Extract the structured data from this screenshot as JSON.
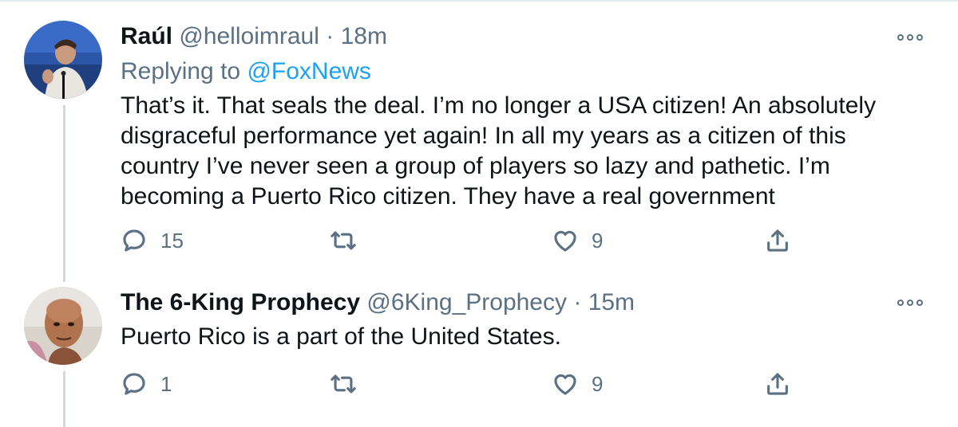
{
  "tweets": [
    {
      "name": "Raúl",
      "handle": "@helloimraul",
      "separator": "·",
      "time": "18m",
      "replying_prefix": "Replying to",
      "replying_to": "@FoxNews",
      "text": "That’s it. That seals the deal. I’m no longer a USA citizen! An absolutely\ndisgraceful performance yet again! In all my years as a citizen of this\ncountry I’ve never seen a group of players so lazy and pathetic. I’m\nbecoming a Puerto Rico citizen. They have a real government",
      "replies": "15",
      "retweets": "",
      "likes": "9",
      "avatar_icon": "avatar-photo"
    },
    {
      "name": "The 6-King Prophecy",
      "handle": "@6King_Prophecy",
      "separator": "·",
      "time": "15m",
      "text": "Puerto Rico is a part of the United States.",
      "replies": "1",
      "retweets": "",
      "likes": "9",
      "avatar_icon": "avatar-cartoon"
    }
  ],
  "icons": {
    "reply": "reply-icon",
    "retweet": "retweet-icon",
    "like": "heart-icon",
    "share": "share-icon",
    "more": "more-icon"
  },
  "colors": {
    "text": "#0f1419",
    "secondary": "#5b7083",
    "link": "#1da1f2",
    "divider": "#e6ecf0"
  }
}
